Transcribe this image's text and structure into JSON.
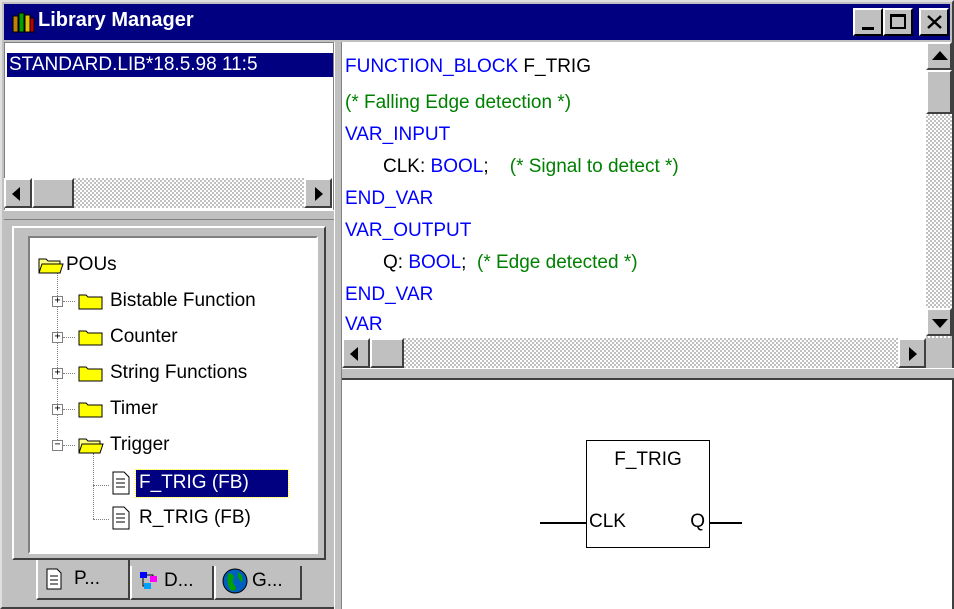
{
  "window": {
    "title": "Library Manager"
  },
  "library_list": {
    "items": [
      "STANDARD.LIB*18.5.98 11:5"
    ]
  },
  "code": {
    "l1_kw": "FUNCTION_BLOCK",
    "l1_name": "F_TRIG",
    "l2": "(* Falling Edge detection *)",
    "l3": "VAR_INPUT",
    "l4_name": "CLK: ",
    "l4_type": "BOOL",
    "l4_semi": ";",
    "l4_comment": "(* Signal to detect *)",
    "l5": "END_VAR",
    "l6": "VAR_OUTPUT",
    "l7_name": "Q: ",
    "l7_type": "BOOL",
    "l7_semi": ";",
    "l7_comment": "(* Edge detected *)",
    "l8": "END_VAR",
    "l9": "VAR"
  },
  "tree": {
    "root": "POUs",
    "folders": [
      "Bistable Function",
      "Counter",
      "String Functions",
      "Timer",
      "Trigger"
    ],
    "trigger_children": [
      "F_TRIG (FB)",
      "R_TRIG (FB)"
    ],
    "selected": "F_TRIG (FB)"
  },
  "tabs": [
    "P...",
    "D...",
    "G..."
  ],
  "fb_block": {
    "name": "F_TRIG",
    "input": "CLK",
    "output": "Q"
  },
  "colors": {
    "titlebar": "#000080",
    "keyword": "#0000ff",
    "comment": "#008000",
    "selection": "#000080"
  },
  "icons": [
    "library-manager-icon",
    "minimize-icon",
    "maximize-icon",
    "close-icon",
    "folder-icon",
    "open-folder-icon",
    "pou-icon",
    "data-types-icon",
    "globe-icon"
  ]
}
